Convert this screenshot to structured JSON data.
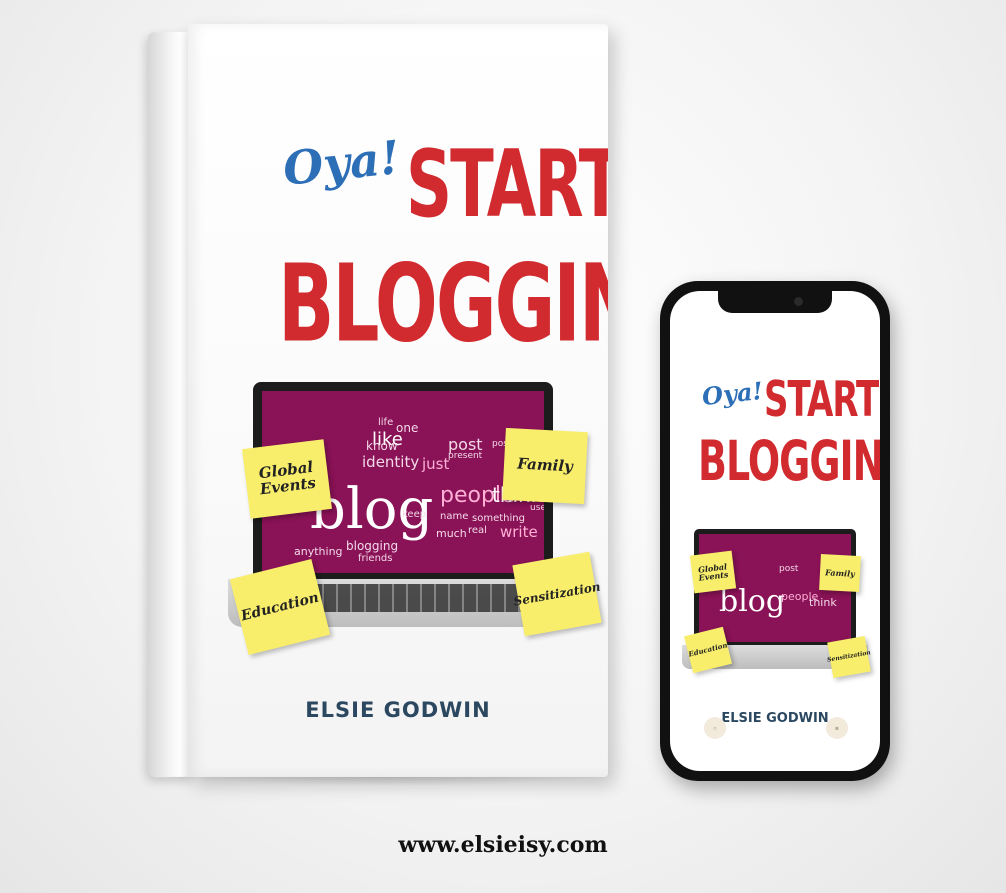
{
  "book": {
    "title_script": "Oya!",
    "title_line1": "START",
    "title_line2": "BLOGGING",
    "author": "ELSIE GODWIN",
    "notes": [
      "Global Events",
      "Family",
      "Education",
      "Sensitization"
    ],
    "screen_words": {
      "main": "blog",
      "large": [
        "people",
        "think",
        "like",
        "identity",
        "just",
        "post",
        "write",
        "know",
        "one"
      ],
      "small": [
        "blogging",
        "anything",
        "friends",
        "much",
        "name",
        "keep",
        "real",
        "something",
        "present",
        "life",
        "posts",
        "use"
      ]
    }
  },
  "phone": {
    "title_script": "Oya!",
    "title_line1": "START",
    "title_line2": "BLOGGING",
    "author": "ELSIE GODWIN",
    "notes": [
      "Global Events",
      "Family",
      "Education",
      "Sensitization"
    ]
  },
  "website": "www.elsieisy.com",
  "colors": {
    "title_red": "#d12a2f",
    "script_blue": "#2d6fb6",
    "screen_magenta": "#8a1257",
    "sticky_yellow": "#f8ee6c",
    "author_navy": "#2b4860"
  }
}
